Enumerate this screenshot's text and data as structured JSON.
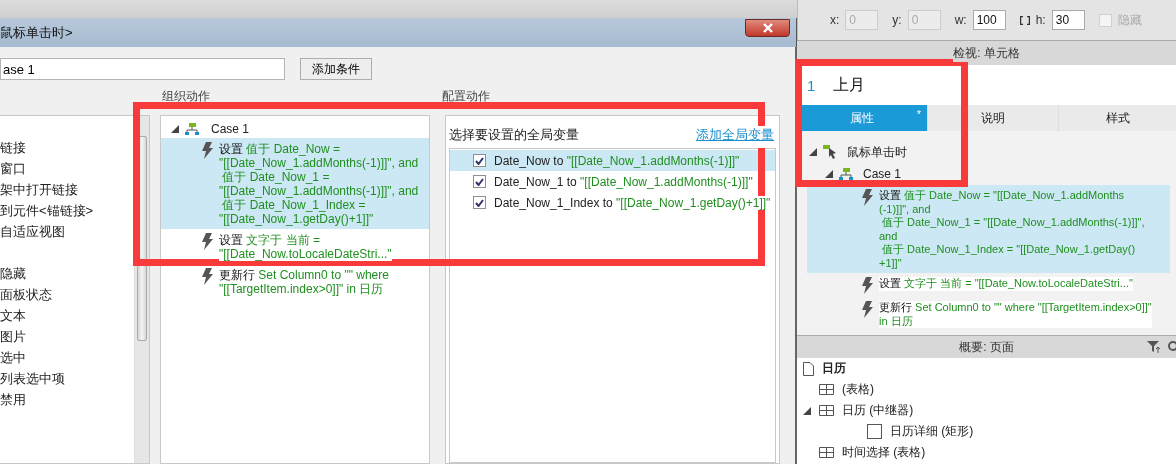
{
  "dialog": {
    "title": "鼠标单击时>",
    "case_name": "ase 1",
    "add_condition_button": "添加条件",
    "action_groups": [
      {
        "items": [
          "链接",
          "窗口",
          "架中打开链接",
          "到元件<锚链接>",
          "自适应视图"
        ]
      },
      {
        "items": [
          "隐藏",
          "面板状态",
          "文本",
          "图片",
          "选中",
          "列表选中项",
          "禁用"
        ]
      }
    ],
    "organize": {
      "label": "组织动作",
      "case": {
        "name": "Case 1",
        "expanded": true,
        "actions": [
          {
            "verb": "设置",
            "lines": [
              "值于 Date_Now =",
              "\"[[Date_Now_1.addMonths(-1)]]\", and",
              " 值于 Date_Now_1 =",
              "\"[[Date_Now_1.addMonths(-1)]]\", and",
              " 值于 Date_Now_1_Index =",
              "\"[[Date_Now_1.getDay()+1]]\""
            ],
            "selected": true
          },
          {
            "verb": "设置",
            "lines": [
              "文字于 当前 =",
              "\"[[Date_Now.toLocaleDateStri...\""
            ],
            "selected": false
          },
          {
            "verb": "更新行",
            "lines": [
              "Set Column0 to \"\" where",
              "\"[[TargetItem.index>0]]\" in 日历"
            ],
            "selected": false
          }
        ]
      }
    },
    "configure": {
      "label": "配置动作",
      "heading": "选择要设置的全局变量",
      "link": "添加全局变量",
      "variables": [
        {
          "name": "Date_Now to",
          "value": "\"[[Date_Now_1.addMonths(-1)]]\"",
          "checked": true,
          "selected": true
        },
        {
          "name": "Date_Now_1 to",
          "value": "\"[[Date_Now_1.addMonths(-1)]]\"",
          "checked": true,
          "selected": false
        },
        {
          "name": "Date_Now_1_Index to",
          "value": "\"[[Date_Now_1.getDay()+1]]\"",
          "checked": true,
          "selected": false
        }
      ]
    }
  },
  "inspector": {
    "fields": [
      {
        "label": "x:",
        "value": "0",
        "disabled": true
      },
      {
        "label": "y:",
        "value": "0",
        "disabled": true
      },
      {
        "label": "w:",
        "value": "100",
        "disabled": false
      },
      {
        "label": "h:",
        "value": "30",
        "disabled": false,
        "linked": true
      }
    ],
    "hidden_checkbox": {
      "label": "隐藏",
      "checked": false,
      "disabled": true
    },
    "title": "检视: 单元格",
    "element": {
      "index": "1",
      "name": "上月"
    },
    "tabs": [
      {
        "label": "属性",
        "selected": true,
        "badge": "*"
      },
      {
        "label": "说明",
        "selected": false
      },
      {
        "label": "样式",
        "selected": false
      }
    ],
    "event": {
      "name": "鼠标单击时",
      "expanded": true,
      "case": {
        "name": "Case 1",
        "expanded": true,
        "actions": [
          {
            "verb": "设置",
            "lines": [
              "值于 Date_Now = \"[[Date_Now_1.addMonths",
              "(-1)]]\", and",
              " 值于 Date_Now_1 = \"[[Date_Now_1.addMonths(-1)]]\",",
              "and",
              " 值于 Date_Now_1_Index = \"[[Date_Now_1.getDay()",
              "+1]]\""
            ],
            "selected": true
          },
          {
            "verb": "设置",
            "lines": [
              "文字于 当前 = \"[[Date_Now.toLocaleDateStri...\""
            ],
            "selected": false
          },
          {
            "verb": "更新行",
            "lines": [
              "Set Column0 to \"\" where \"[[TargetItem.index>0]]\"",
              "in 日历"
            ],
            "selected": false
          }
        ]
      }
    }
  },
  "outline": {
    "title": "概要: 页面",
    "page": "日历",
    "items": [
      {
        "label": "(表格)",
        "kind": "table"
      },
      {
        "label": "日历 (中继器)",
        "kind": "table",
        "expanded": true,
        "children": [
          {
            "label": "日历详细 (矩形)",
            "kind": "rectangle"
          }
        ]
      },
      {
        "label": "时间选择 (表格)",
        "kind": "table"
      }
    ]
  }
}
